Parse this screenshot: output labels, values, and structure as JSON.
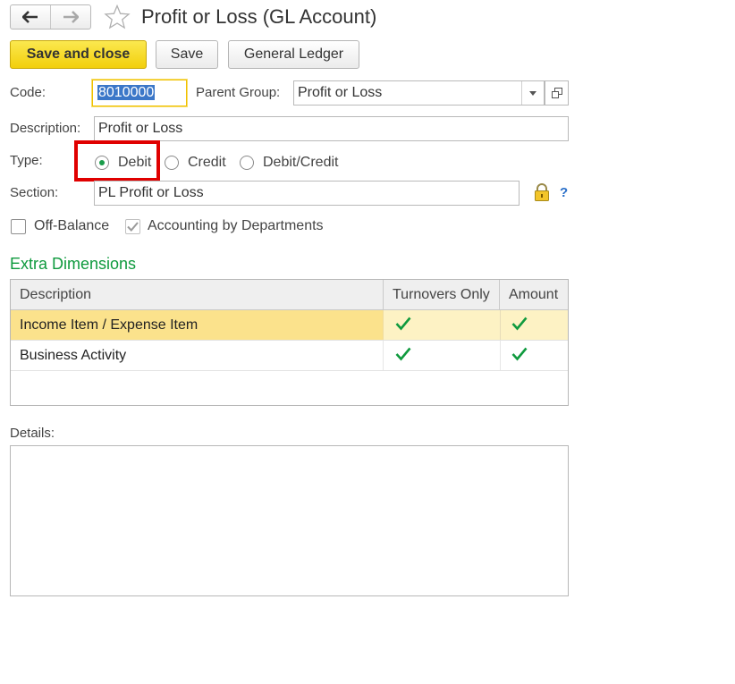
{
  "window": {
    "title": "Profit or Loss (GL Account)"
  },
  "toolbar": {
    "save_close_label": "Save and close",
    "save_label": "Save",
    "general_ledger_label": "General Ledger"
  },
  "form": {
    "code_label": "Code:",
    "code_value": "8010000",
    "parent_group_label": "Parent Group:",
    "parent_group_value": "Profit or Loss",
    "description_label": "Description:",
    "description_value": "Profit or Loss",
    "type_label": "Type:",
    "type_options": [
      {
        "label": "Debit",
        "selected": true
      },
      {
        "label": "Credit",
        "selected": false
      },
      {
        "label": "Debit/Credit",
        "selected": false
      }
    ],
    "section_label": "Section:",
    "section_value": "PL Profit or Loss",
    "help_glyph": "?",
    "off_balance_label": "Off-Balance",
    "off_balance_checked": false,
    "accounting_by_departments_label": "Accounting by Departments",
    "accounting_by_departments_checked": true
  },
  "extra_dimensions": {
    "title": "Extra Dimensions",
    "columns": [
      "Description",
      "Turnovers Only",
      "Amount"
    ],
    "rows": [
      {
        "description": "Income Item / Expense Item",
        "turnovers_only": true,
        "amount": true,
        "selected": true
      },
      {
        "description": "Business Activity",
        "turnovers_only": true,
        "amount": true,
        "selected": false
      }
    ]
  },
  "details": {
    "label": "Details:",
    "value": ""
  },
  "colors": {
    "accent_green": "#0f9a3e",
    "primary_button": "#f2cf0c",
    "selected_row": "#fbe28c",
    "highlight_red": "#e00000"
  }
}
